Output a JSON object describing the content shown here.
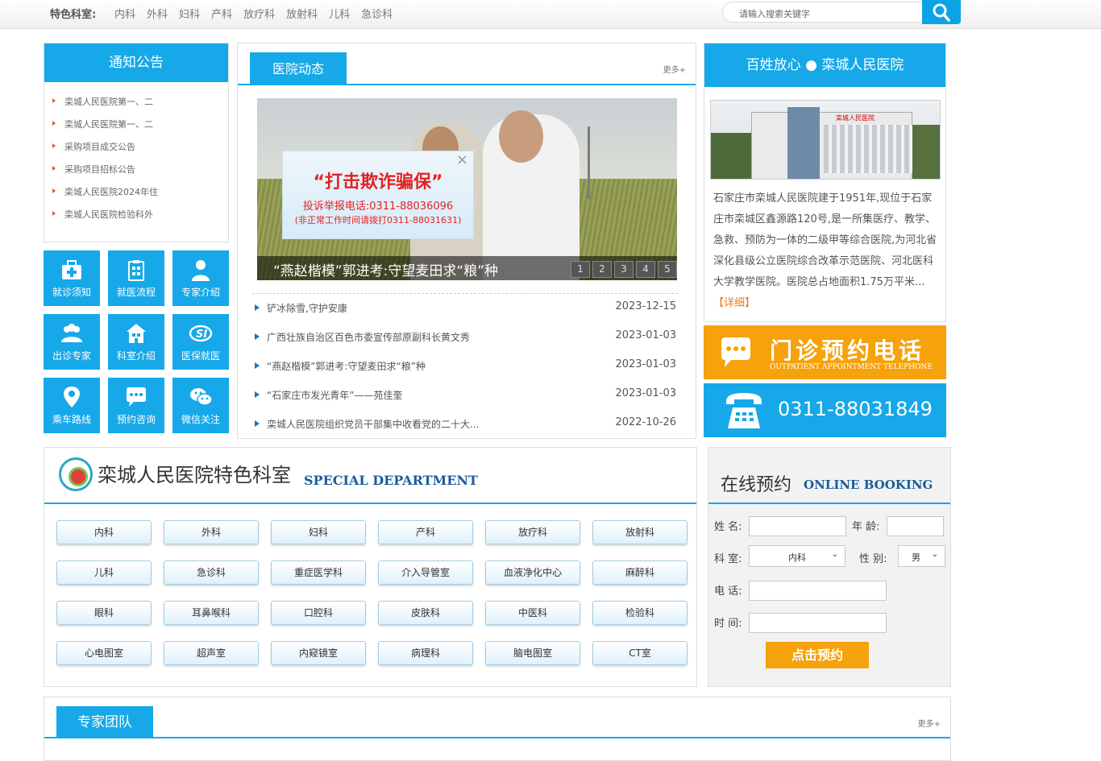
{
  "topbar": {
    "label": "特色科室:",
    "links": [
      "内科",
      "外科",
      "妇科",
      "产科",
      "放疗科",
      "放射科",
      "儿科",
      "急诊科"
    ],
    "search_placeholder": "请输入搜索关键字"
  },
  "notice": {
    "title": "通知公告",
    "items": [
      "栾城人民医院第一、二",
      "栾城人民医院第一、二",
      "采购项目成交公告",
      "采购项目招标公告",
      "栾城人民医院2024年住",
      "栾城人民医院检验科外"
    ]
  },
  "tiles": [
    "就诊须知",
    "就医流程",
    "专家介绍",
    "出诊专家",
    "科室介绍",
    "医保就医",
    "乘车路线",
    "预约咨询",
    "微信关注"
  ],
  "news": {
    "title": "医院动态",
    "more": "更多+",
    "slide_caption": "“燕赵楷模”郭进考:守望麦田求“粮”种",
    "slide_dots": [
      "1",
      "2",
      "3",
      "4",
      "5"
    ],
    "popup": {
      "close": "×",
      "headline": "“打击欺诈骗保”",
      "phone_line": "投诉举报电话:0311-88036096",
      "after_hours": "(非正常工作时间请拨打0311-88031631)"
    },
    "items": [
      {
        "title": "铲冰除雪,守护安康",
        "date": "2023-12-15"
      },
      {
        "title": "广西壮族自治区百色市委宣传部原副科长黄文秀",
        "date": "2023-01-03"
      },
      {
        "title": "“燕赵楷模”郭进考:守望麦田求“粮”种",
        "date": "2023-01-03"
      },
      {
        "title": "“石家庄市发光青年”——苑佳奎",
        "date": "2023-01-03"
      },
      {
        "title": "栾城人民医院组织党员干部集中收看党的二十大...",
        "date": "2022-10-26"
      }
    ]
  },
  "intro": {
    "title": "百姓放心 ● 栾城人民医院",
    "building_sign": "栾城人民医院",
    "text": "石家庄市栾城人民医院建于1951年,现位于石家庄市栾城区鑫源路120号,是一所集医疗、教学、急救、预防为一体的二级甲等综合医院,为河北省深化县级公立医院综合改革示范医院、河北医科大学教学医院。医院总占地面积1.75万平米...",
    "more": "【详细】"
  },
  "phone": {
    "title": "门诊预约电话",
    "subtitle": "OUTPATIENT APPOINTMENT TELEPHONE",
    "number": "0311-88031849"
  },
  "dept": {
    "title": "栾城人民医院特色科室",
    "title_en": "SPECIAL DEPARTMENT",
    "items": [
      "内科",
      "外科",
      "妇科",
      "产科",
      "放疗科",
      "放射科",
      "儿科",
      "急诊科",
      "重症医学科",
      "介入导管室",
      "血液净化中心",
      "麻醉科",
      "眼科",
      "耳鼻喉科",
      "口腔科",
      "皮肤科",
      "中医科",
      "检验科",
      "心电图室",
      "超声室",
      "内窥镜室",
      "病理科",
      "脑电图室",
      "CT室"
    ]
  },
  "booking": {
    "title": "在线预约",
    "title_en": "ONLINE BOOKING",
    "name_label": "姓 名:",
    "age_label": "年 龄:",
    "dept_label": "科 室:",
    "dept_value": "内科",
    "gender_label": "性 别:",
    "gender_value": "男",
    "phone_label": "电 话:",
    "time_label": "时 间:",
    "submit": "点击预约"
  },
  "expert": {
    "title": "专家团队",
    "more": "更多+"
  },
  "colors": {
    "accent": "#16a8e8",
    "orange": "#f5a20c",
    "alert_red": "#e32222"
  }
}
